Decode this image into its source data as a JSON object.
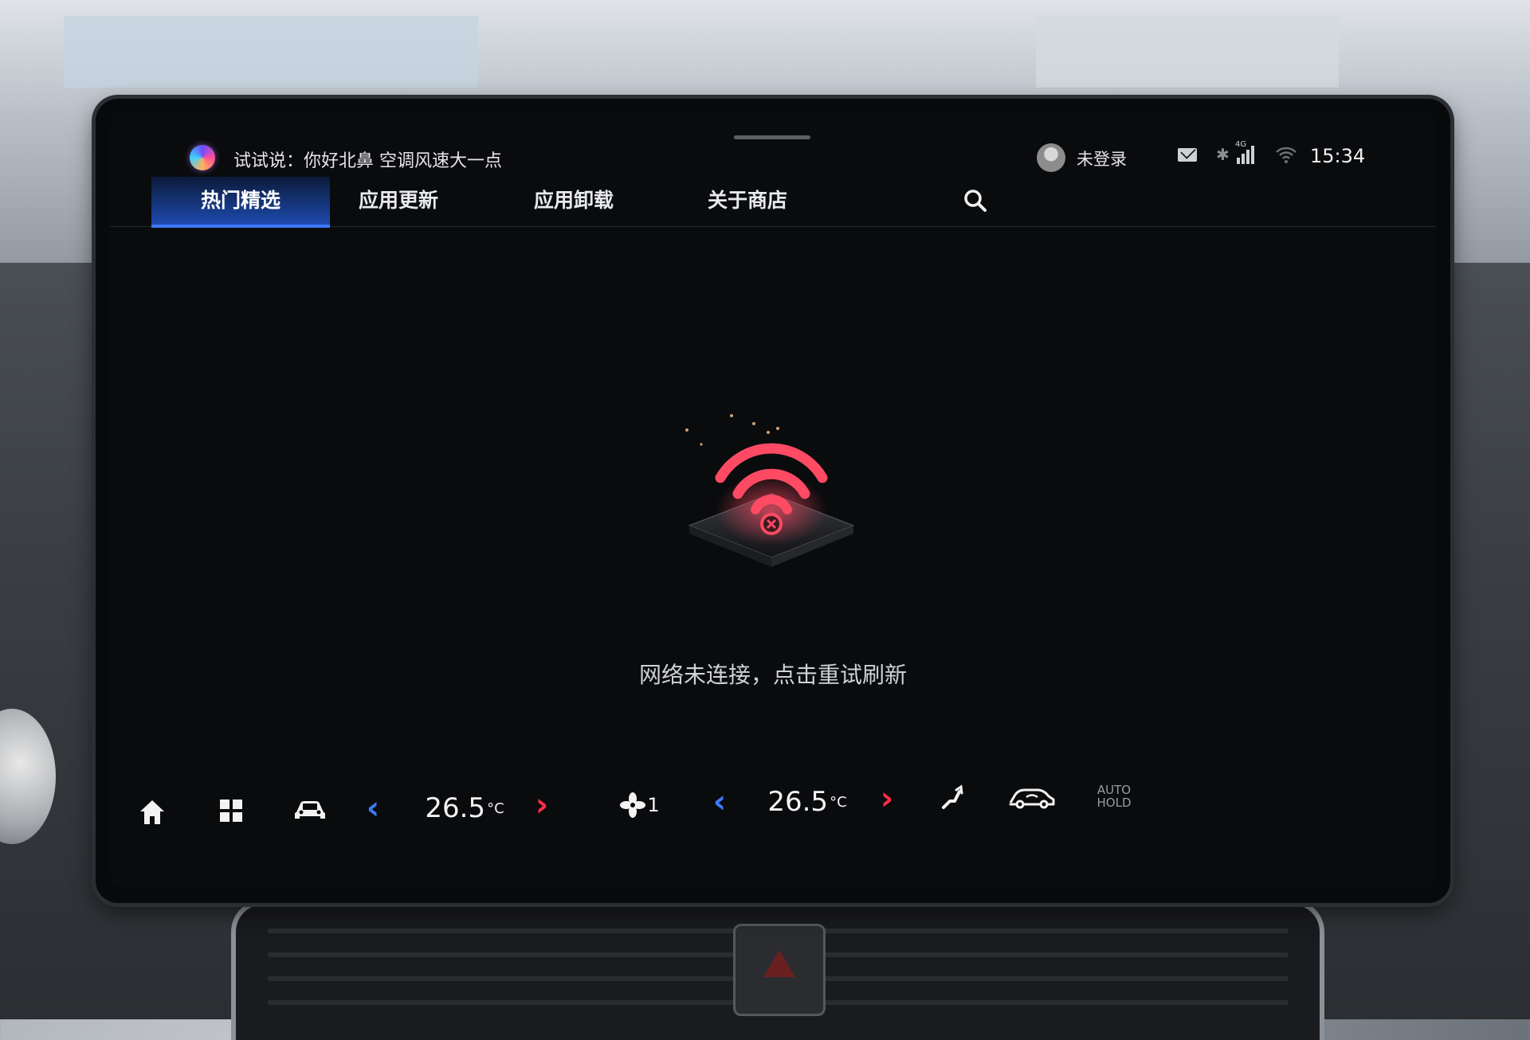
{
  "status_bar": {
    "assistant_hint": "试试说：你好北鼻 空调风速大一点",
    "login_status": "未登录",
    "signal_label": "4G",
    "time": "15:34"
  },
  "tabs": [
    {
      "label": "热门精选",
      "active": true
    },
    {
      "label": "应用更新",
      "active": false
    },
    {
      "label": "应用卸载",
      "active": false
    },
    {
      "label": "关于商店",
      "active": false
    }
  ],
  "empty_state": {
    "message": "网络未连接，点击重试刷新",
    "icon": "wifi-disconnected-icon",
    "accent_color": "#ff4a63"
  },
  "climate": {
    "left_temp": "26.5",
    "right_temp": "26.5",
    "temp_unit": "°C",
    "fan_speed": "1",
    "auto_hold_line1": "AUTO",
    "auto_hold_line2": "HOLD"
  },
  "colors": {
    "tab_active": "#1e4bb0",
    "arrow_decrease": "#3e7bff",
    "arrow_increase": "#ff2d45"
  }
}
